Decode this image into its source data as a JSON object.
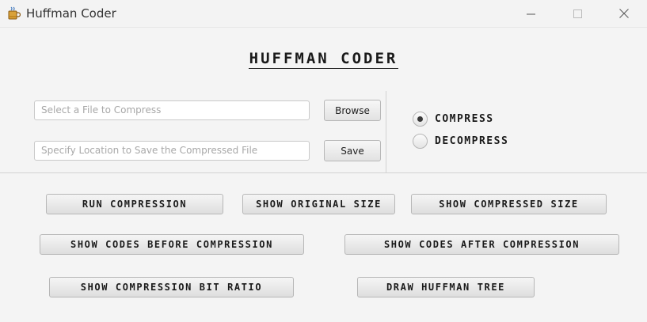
{
  "window": {
    "title": "Huffman Coder",
    "controls": [
      "minimize",
      "maximize",
      "close"
    ]
  },
  "heading": "HUFFMAN CODER",
  "file_section": {
    "compress_input": {
      "placeholder": "Select a File to Compress",
      "value": ""
    },
    "browse_label": "Browse",
    "save_input": {
      "placeholder": "Specify Location to Save the Compressed File",
      "value": ""
    },
    "save_label": "Save"
  },
  "mode": {
    "options": [
      {
        "label": "COMPRESS",
        "selected": true
      },
      {
        "label": "DECOMPRESS",
        "selected": false
      }
    ]
  },
  "actions": {
    "run_compression": "RUN COMPRESSION",
    "show_original_size": "SHOW ORIGINAL SIZE",
    "show_compressed_size": "SHOW COMPRESSED SIZE",
    "show_codes_before": "SHOW CODES BEFORE COMPRESSION",
    "show_codes_after": "SHOW CODES AFTER COMPRESSION",
    "show_bit_ratio": "SHOW COMPRESSION BIT RATIO",
    "draw_tree": "DRAW HUFFMAN TREE"
  },
  "icons": {
    "app": "coffee-cup-icon",
    "minimize": "minimize-icon",
    "maximize": "maximize-icon",
    "close": "close-icon"
  }
}
